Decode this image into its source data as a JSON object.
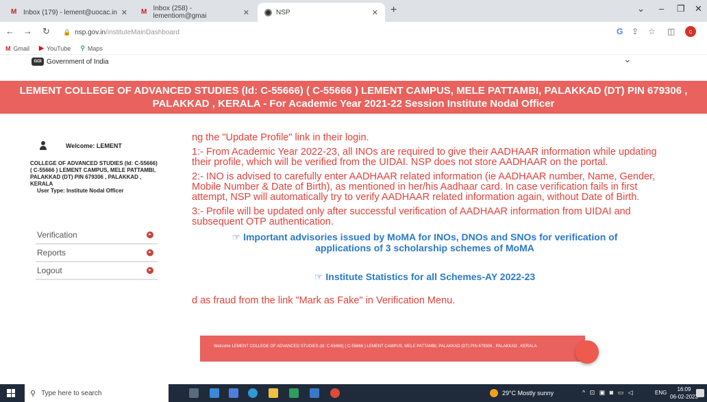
{
  "browser": {
    "tabs": [
      {
        "title": "Inbox (179) - lement@uocac.in"
      },
      {
        "title": "Inbox (258) - lementiom@gmai"
      },
      {
        "title": "NSP"
      }
    ],
    "url_host": "nsp.gov.in",
    "url_path": "/instituteMainDashboard",
    "profile_initial": "c",
    "bookmarks": [
      {
        "label": "Gmail"
      },
      {
        "label": "YouTube"
      },
      {
        "label": "Maps"
      }
    ]
  },
  "header": {
    "gov_text": "Government of India",
    "banner": "LEMENT COLLEGE OF ADVANCED STUDIES (Id: C-55666) ( C-55666 ) LEMENT CAMPUS, MELE PATTAMBI, PALAKKAD (DT) PIN 679306 , PALAKKAD , KERALA - For Academic Year 2021-22 Session   Institute Nodal Officer"
  },
  "sidebar": {
    "welcome": "Welcome: LEMENT",
    "institute": "COLLEGE OF ADVANCED STUDIES (Id: C-55666) ( C-55666 ) LEMENT CAMPUS, MELE PATTAMBI, PALAKKAD (DT) PIN 679306 , PALAKKAD , KERALA",
    "user_type": "User Type:   Institute Nodal Officer",
    "menu": [
      {
        "label": "Verification"
      },
      {
        "label": "Reports"
      },
      {
        "label": "Logout"
      }
    ]
  },
  "main": {
    "line0": "ng the \"Update Profile\" link in their login.",
    "para1": "1:- From Academic Year 2022-23, all INOs are required to give their AADHAAR information while updating their profile, which will be verified from the UIDAI. NSP does not store AADHAAR on the portal.",
    "para2": "2:- INO is advised to carefully enter AADHAAR related information (ie AADHAAR number, Name, Gender, Mobile Number & Date of Birth), as mentioned in her/his Aadhaar card. In case verification fails in first attempt, NSP will automatically try to verify AADHAAR related information again, without Date of Birth.",
    "para3": "3:- Profile will be updated only after successful verification of AADHAAR information from UIDAI and subsequent OTP authentication.",
    "link1": "Important advisories issued by MoMA for INOs, DNOs and SNOs for verification of applications of 3 scholarship schemes of MoMA",
    "link2": "Institute Statistics for all Schemes-AY 2022-23",
    "fraud": "d as fraud from the link \"Mark as Fake\" in Verification Menu.",
    "footer": "Welcome LEMENT COLLEGE OF ADVANCED STUDIES (Id: C-55666) ( C-55666 ) LEMENT CAMPUS, MELE PATTAMBI, PALAKKAD (DT) PIN 679306 , PALAKKAD , KERALA"
  },
  "taskbar": {
    "search_placeholder": "Type here to search",
    "weather": "29°C  Mostly sunny",
    "lang": "ENG",
    "time": "16:09",
    "date": "06-02-2023"
  }
}
